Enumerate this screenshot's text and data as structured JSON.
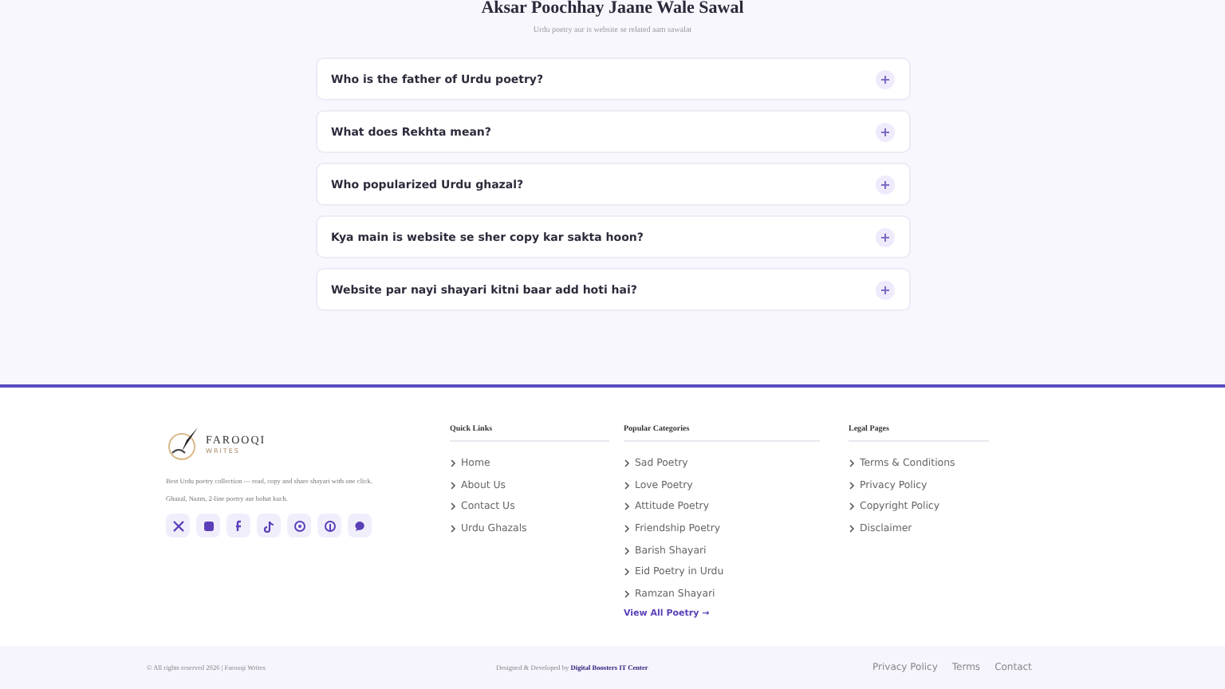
{
  "faq": {
    "title": "Aksar Poochhay Jaane Wale Sawal",
    "subtitle": "Urdu poetry aur is website se related aam sawalat",
    "items": [
      {
        "question": "Who is the father of Urdu poetry?",
        "expanded": false
      },
      {
        "question": "What does Rekhta mean?",
        "expanded": false
      },
      {
        "question": "Who popularized Urdu ghazal?",
        "expanded": false
      },
      {
        "question": "Kya main is website se sher copy kar sakta hoon?",
        "expanded": false
      },
      {
        "question": "Website par nayi shayari kitni baar add hoti hai?",
        "expanded": false
      }
    ]
  },
  "footer": {
    "logo": {
      "name": "FAROOQI",
      "tagline": "WRITES"
    },
    "about": [
      "Best Urdu poetry collection — read, copy and share shayari with one click.",
      "Ghazal, Nazm, 2-line poetry aur bohat kuch."
    ],
    "socials": [
      {
        "kind": "x"
      },
      {
        "kind": "instagram"
      },
      {
        "kind": "facebook"
      },
      {
        "kind": "tiktok"
      },
      {
        "kind": "threads"
      },
      {
        "kind": "pinterest"
      },
      {
        "kind": "chat"
      }
    ],
    "columns": [
      {
        "title": "Quick Links",
        "links": [
          "Home",
          "About Us",
          "Contact Us",
          "Urdu Ghazals"
        ]
      },
      {
        "title": "Popular Categories",
        "links": [
          "Sad Poetry",
          "Love Poetry",
          "Attitude Poetry",
          "Friendship Poetry",
          "Barish Shayari",
          "Eid Poetry in Urdu",
          "Ramzan Shayari"
        ],
        "more": "View All Poetry →"
      },
      {
        "title": "Legal Pages",
        "links": [
          "Terms & Conditions",
          "Privacy Policy",
          "Copyright Policy",
          "Disclaimer"
        ]
      }
    ]
  },
  "bottom_bar": {
    "copyright": "© All rights reserved 2026 | Farooqi Writes",
    "credit_prefix": "Designed & Developed by",
    "credit_link": "Digital Boosters IT Center",
    "links": [
      "Privacy Policy",
      "Terms",
      "Contact"
    ]
  }
}
